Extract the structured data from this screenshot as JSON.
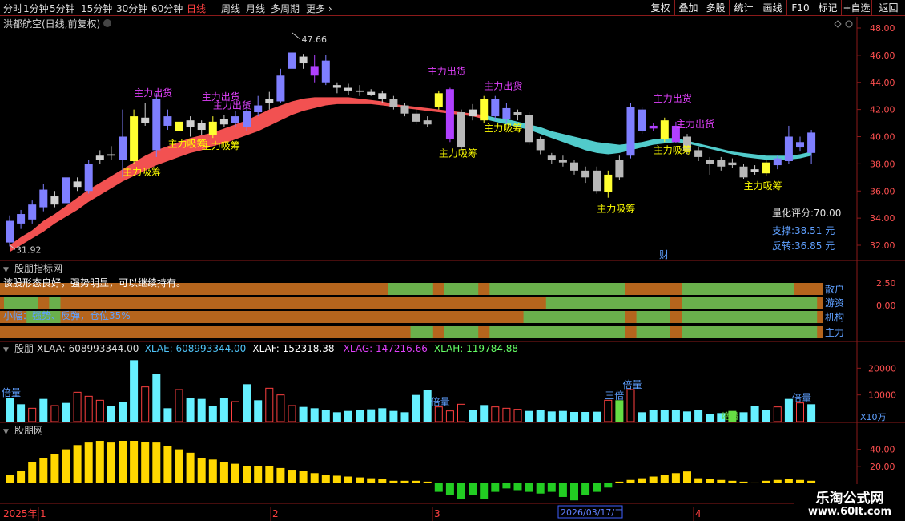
{
  "toolbar": {
    "periods": [
      "分时",
      "1分钟",
      "5分钟",
      "15分钟",
      "30分钟",
      "60分钟",
      "日线",
      "周线",
      "月线",
      "多周期",
      "更多"
    ],
    "active_period": "日线",
    "right_buttons": [
      "复权",
      "叠加",
      "多股",
      "统计",
      "画线",
      "F10",
      "标记",
      "+自选",
      "返回"
    ]
  },
  "main_panel": {
    "title": "洪都航空(日线,前复权)",
    "high_label": "47.66",
    "low_label": "31.92",
    "y_ticks": [
      "48.00",
      "46.00",
      "44.00",
      "42.00",
      "40.00",
      "38.00",
      "36.00",
      "34.00",
      "32.00"
    ],
    "score_label": "量化评分:70.00",
    "support_label": "支撑:38.51 元",
    "reversal_label": "反转:36.85 元",
    "finance_marker": "财",
    "sell_label": "主力出货",
    "buy_label": "主力吸筹"
  },
  "indicator_panel": {
    "title": "股朋指标网",
    "message1": "该股形态良好，强势明显，可以继续持有。",
    "message2": "小幅：强势、反弹，仓位35%",
    "y_ticks": [
      "2.50",
      "0.00"
    ],
    "row_labels": [
      "散户",
      "游资",
      "机构",
      "主力"
    ]
  },
  "volume_panel": {
    "title": "股朋",
    "legend": [
      {
        "label": "XLAA: 608993344.00",
        "color": "#dddddd"
      },
      {
        "label": "XLAE: 608993344.00",
        "color": "#4fc3f7"
      },
      {
        "label": "XLAF: 152318.38",
        "color": "#ffffff"
      },
      {
        "label": "XLAG: 147216.66",
        "color": "#e040fb"
      },
      {
        "label": "XLAH: 119784.88",
        "color": "#66ff66"
      }
    ],
    "y_ticks": [
      "20000",
      "10000"
    ],
    "unit_label": "X10万",
    "double_label": "倍量",
    "triple_label": "三倍",
    "shrink_label": "缩量"
  },
  "osc_panel": {
    "title": "股朋网",
    "y_ticks": [
      "40.00",
      "20.00"
    ]
  },
  "time_axis": {
    "labels": [
      "2025年",
      "1",
      "2",
      "3",
      "4"
    ],
    "cursor_date": "2026/03/17/二"
  },
  "watermark": {
    "title": "乐淘公式网",
    "url": "www.60lt.com"
  },
  "colors": {
    "up": "#ff4040",
    "down": "#8080ff",
    "sell_text": "#e040fb",
    "buy_text": "#ffff00",
    "bar_orange": "#b5651d",
    "bar_green": "#6ab04c",
    "ribbon_red": "#ff5555",
    "ribbon_cyan": "#55d6d6",
    "frame": "#8b1a1a"
  },
  "chart_data": {
    "type": "candlestick",
    "price_range": [
      31,
      49
    ],
    "candles": [
      {
        "o": 32.2,
        "c": 33.8,
        "h": 34.2,
        "l": 31.92,
        "k": "b"
      },
      {
        "o": 33.6,
        "c": 34.3,
        "h": 34.6,
        "l": 33.2,
        "k": "b"
      },
      {
        "o": 33.9,
        "c": 35.0,
        "h": 35.3,
        "l": 33.6,
        "k": "b"
      },
      {
        "o": 34.8,
        "c": 36.1,
        "h": 36.5,
        "l": 34.5,
        "k": "b"
      },
      {
        "o": 35.6,
        "c": 35.0,
        "h": 36.0,
        "l": 34.8,
        "k": "w"
      },
      {
        "o": 35.1,
        "c": 37.0,
        "h": 37.3,
        "l": 34.9,
        "k": "b"
      },
      {
        "o": 36.7,
        "c": 36.3,
        "h": 37.0,
        "l": 36.0,
        "k": "w"
      },
      {
        "o": 36.0,
        "c": 38.0,
        "h": 38.3,
        "l": 35.8,
        "k": "b"
      },
      {
        "o": 38.3,
        "c": 38.6,
        "h": 39.0,
        "l": 38.0,
        "k": "w"
      },
      {
        "o": 38.6,
        "c": 38.7,
        "h": 39.3,
        "l": 38.3,
        "k": "w"
      },
      {
        "o": 38.3,
        "c": 40.0,
        "h": 42.0,
        "l": 37.0,
        "k": "b"
      },
      {
        "o": 38.2,
        "c": 41.5,
        "h": 42.0,
        "l": 38.0,
        "k": "y"
      },
      {
        "o": 41.0,
        "c": 41.4,
        "h": 42.5,
        "l": 40.8,
        "k": "w"
      },
      {
        "o": 39.0,
        "c": 42.8,
        "h": 43.2,
        "l": 38.5,
        "k": "b"
      },
      {
        "o": 41.5,
        "c": 40.8,
        "h": 42.0,
        "l": 40.5,
        "k": "b"
      },
      {
        "o": 41.1,
        "c": 40.4,
        "h": 42.3,
        "l": 40.3,
        "k": "y"
      },
      {
        "o": 40.7,
        "c": 41.2,
        "h": 41.5,
        "l": 40.0,
        "k": "w"
      },
      {
        "o": 40.5,
        "c": 41.0,
        "h": 41.2,
        "l": 40.1,
        "k": "w"
      },
      {
        "o": 41.1,
        "c": 40.1,
        "h": 41.5,
        "l": 39.9,
        "k": "y"
      },
      {
        "o": 40.9,
        "c": 41.3,
        "h": 41.6,
        "l": 40.7,
        "k": "w"
      },
      {
        "o": 41.0,
        "c": 41.5,
        "h": 41.9,
        "l": 40.7,
        "k": "b"
      },
      {
        "o": 40.7,
        "c": 41.9,
        "h": 42.5,
        "l": 40.4,
        "k": "b"
      },
      {
        "o": 41.8,
        "c": 42.3,
        "h": 43.0,
        "l": 41.5,
        "k": "b"
      },
      {
        "o": 42.5,
        "c": 42.8,
        "h": 43.3,
        "l": 42.0,
        "k": "w"
      },
      {
        "o": 42.6,
        "c": 44.5,
        "h": 45.0,
        "l": 42.5,
        "k": "b"
      },
      {
        "o": 45.0,
        "c": 46.2,
        "h": 47.66,
        "l": 44.8,
        "k": "b"
      },
      {
        "o": 45.4,
        "c": 45.9,
        "h": 46.1,
        "l": 45.0,
        "k": "w"
      },
      {
        "o": 45.2,
        "c": 44.5,
        "h": 46.0,
        "l": 44.0,
        "k": "p"
      },
      {
        "o": 45.6,
        "c": 44.0,
        "h": 46.0,
        "l": 43.8,
        "k": "b"
      },
      {
        "o": 43.8,
        "c": 43.6,
        "h": 44.0,
        "l": 43.2,
        "k": "w"
      },
      {
        "o": 43.6,
        "c": 43.4,
        "h": 43.9,
        "l": 43.1,
        "k": "w"
      },
      {
        "o": 43.4,
        "c": 43.3,
        "h": 43.8,
        "l": 43.0,
        "k": "w"
      },
      {
        "o": 43.3,
        "c": 43.1,
        "h": 43.5,
        "l": 43.0,
        "k": "w"
      },
      {
        "o": 43.2,
        "c": 42.8,
        "h": 43.4,
        "l": 42.5,
        "k": "w"
      },
      {
        "o": 42.8,
        "c": 42.2,
        "h": 43.0,
        "l": 42.0,
        "k": "g"
      },
      {
        "o": 42.3,
        "c": 41.7,
        "h": 42.5,
        "l": 41.5,
        "k": "g"
      },
      {
        "o": 41.7,
        "c": 41.1,
        "h": 42.0,
        "l": 40.9,
        "k": "g"
      },
      {
        "o": 41.2,
        "c": 40.9,
        "h": 41.5,
        "l": 40.7,
        "k": "g"
      },
      {
        "o": 42.2,
        "c": 43.2,
        "h": 43.4,
        "l": 42.0,
        "k": "y"
      },
      {
        "o": 43.5,
        "c": 39.8,
        "h": 43.6,
        "l": 39.6,
        "k": "p"
      },
      {
        "o": 41.8,
        "c": 39.2,
        "h": 42.0,
        "l": 39.0,
        "k": "g"
      },
      {
        "o": 41.5,
        "c": 42.0,
        "h": 42.4,
        "l": 41.2,
        "k": "w"
      },
      {
        "o": 41.2,
        "c": 42.8,
        "h": 43.0,
        "l": 41.0,
        "k": "y"
      },
      {
        "o": 42.8,
        "c": 41.5,
        "h": 43.0,
        "l": 41.2,
        "k": "b"
      },
      {
        "o": 42.1,
        "c": 41.3,
        "h": 42.5,
        "l": 41.0,
        "k": "b"
      },
      {
        "o": 41.8,
        "c": 41.6,
        "h": 42.0,
        "l": 41.2,
        "k": "g"
      },
      {
        "o": 41.6,
        "c": 39.6,
        "h": 41.8,
        "l": 39.4,
        "k": "g"
      },
      {
        "o": 39.8,
        "c": 39.0,
        "h": 40.0,
        "l": 38.7,
        "k": "g"
      },
      {
        "o": 38.6,
        "c": 38.3,
        "h": 38.8,
        "l": 38.0,
        "k": "g"
      },
      {
        "o": 38.3,
        "c": 38.1,
        "h": 38.6,
        "l": 37.8,
        "k": "g"
      },
      {
        "o": 38.1,
        "c": 37.5,
        "h": 38.3,
        "l": 37.2,
        "k": "g"
      },
      {
        "o": 37.5,
        "c": 37.0,
        "h": 37.8,
        "l": 36.6,
        "k": "g"
      },
      {
        "o": 37.5,
        "c": 36.0,
        "h": 37.8,
        "l": 35.8,
        "k": "g"
      },
      {
        "o": 35.9,
        "c": 37.2,
        "h": 37.5,
        "l": 35.5,
        "k": "y"
      },
      {
        "o": 37.0,
        "c": 38.3,
        "h": 38.6,
        "l": 36.8,
        "k": "g"
      },
      {
        "o": 38.6,
        "c": 42.2,
        "h": 42.5,
        "l": 38.4,
        "k": "b"
      },
      {
        "o": 42.0,
        "c": 40.4,
        "h": 42.2,
        "l": 40.2,
        "k": "b"
      },
      {
        "o": 40.6,
        "c": 40.8,
        "h": 41.0,
        "l": 40.4,
        "k": "p"
      },
      {
        "o": 41.2,
        "c": 39.8,
        "h": 41.4,
        "l": 39.6,
        "k": "y"
      },
      {
        "o": 40.8,
        "c": 39.6,
        "h": 41.1,
        "l": 39.5,
        "k": "p"
      },
      {
        "o": 40.0,
        "c": 39.0,
        "h": 40.2,
        "l": 38.7,
        "k": "g"
      },
      {
        "o": 39.0,
        "c": 38.5,
        "h": 39.2,
        "l": 38.2,
        "k": "g"
      },
      {
        "o": 38.3,
        "c": 38.0,
        "h": 38.5,
        "l": 37.2,
        "k": "g"
      },
      {
        "o": 38.3,
        "c": 37.8,
        "h": 38.5,
        "l": 37.5,
        "k": "g"
      },
      {
        "o": 38.1,
        "c": 37.9,
        "h": 38.4,
        "l": 37.7,
        "k": "g"
      },
      {
        "o": 37.8,
        "c": 37.0,
        "h": 38.0,
        "l": 36.9,
        "k": "g"
      },
      {
        "o": 37.4,
        "c": 37.6,
        "h": 37.9,
        "l": 37.2,
        "k": "w"
      },
      {
        "o": 37.3,
        "c": 38.1,
        "h": 38.3,
        "l": 37.1,
        "k": "y"
      },
      {
        "o": 38.4,
        "c": 37.9,
        "h": 38.6,
        "l": 37.6,
        "k": "b"
      },
      {
        "o": 38.2,
        "c": 40.0,
        "h": 40.8,
        "l": 38.0,
        "k": "b"
      },
      {
        "o": 39.6,
        "c": 39.2,
        "h": 40.0,
        "l": 38.9,
        "k": "b"
      },
      {
        "o": 38.8,
        "c": 40.3,
        "h": 40.5,
        "l": 38.0,
        "k": "b"
      }
    ],
    "sell_signals": [
      12,
      18,
      19,
      38,
      43,
      58,
      60
    ],
    "buy_signals": [
      11,
      15,
      18,
      39,
      43,
      53,
      58,
      66
    ],
    "ribbon_upper": [
      32.0,
      32.6,
      33.1,
      33.8,
      34.3,
      34.9,
      35.5,
      36.1,
      36.6,
      37.1,
      37.6,
      38.1,
      38.6,
      39.0,
      39.3,
      39.6,
      39.9,
      40.1,
      40.3,
      40.6,
      40.9,
      41.2,
      41.6,
      42.0,
      42.3,
      42.6,
      42.8,
      42.9,
      42.9,
      42.9,
      42.9,
      42.8,
      42.7,
      42.6,
      42.4,
      42.3,
      42.2,
      42.1,
      42.0,
      41.9,
      41.8,
      41.7,
      41.6,
      41.4,
      41.3,
      41.1,
      40.9,
      40.7,
      40.4,
      40.2,
      40.0,
      39.8,
      39.6,
      39.5,
      39.4,
      39.5,
      39.6,
      39.8,
      39.9,
      39.9,
      39.7,
      39.5,
      39.3,
      39.1,
      38.9,
      38.8,
      38.7,
      38.6,
      38.6,
      38.6,
      38.7,
      38.9
    ],
    "ribbon_lower": [
      31.5,
      32.0,
      32.5,
      33.0,
      33.6,
      34.1,
      34.6,
      35.2,
      35.7,
      36.2,
      36.7,
      37.1,
      37.5,
      37.9,
      38.2,
      38.5,
      38.8,
      39.0,
      39.3,
      39.5,
      39.8,
      40.1,
      40.4,
      40.8,
      41.2,
      41.6,
      41.9,
      42.1,
      42.3,
      42.4,
      42.4,
      42.4,
      42.4,
      42.3,
      42.2,
      42.1,
      42.0,
      41.9,
      41.8,
      41.7,
      41.6,
      41.5,
      41.3,
      41.1,
      40.9,
      40.7,
      40.5,
      40.2,
      39.9,
      39.6,
      39.3,
      39.0,
      38.8,
      38.7,
      38.8,
      39.0,
      39.2,
      39.4,
      39.5,
      39.6,
      39.5,
      39.3,
      39.1,
      38.9,
      38.7,
      38.5,
      38.4,
      38.3,
      38.3,
      38.3,
      38.4,
      38.6
    ],
    "ribbon_color_switch_index": 42,
    "indicator_rows": [
      {
        "name": "散户",
        "green_ranges": [
          [
            34,
            38
          ],
          [
            39,
            42
          ],
          [
            43,
            55
          ],
          [
            60,
            70
          ]
        ]
      },
      {
        "name": "游资",
        "green_ranges": [
          [
            0,
            3
          ],
          [
            4,
            5
          ],
          [
            48,
            59
          ],
          [
            60,
            72
          ]
        ]
      },
      {
        "name": "机构",
        "green_ranges": [
          [
            2,
            5
          ],
          [
            46,
            55
          ],
          [
            56,
            59
          ],
          [
            60,
            72
          ]
        ]
      },
      {
        "name": "主力",
        "green_ranges": [
          [
            36,
            38
          ],
          [
            39,
            42
          ],
          [
            43,
            55
          ],
          [
            56,
            59
          ],
          [
            60,
            72
          ]
        ]
      }
    ],
    "volume": [
      9000,
      6500,
      5000,
      8500,
      6000,
      7000,
      11000,
      9500,
      8000,
      6000,
      7500,
      23000,
      13000,
      18000,
      5000,
      12000,
      9000,
      8500,
      6000,
      9000,
      7500,
      14000,
      8000,
      12500,
      10000,
      6000,
      5500,
      5000,
      4500,
      3500,
      4000,
      4200,
      4600,
      5000,
      4000,
      3500,
      10000,
      12000,
      5500,
      4000,
      6500,
      4500,
      6200,
      5500,
      5000,
      4600,
      4000,
      4200,
      3800,
      4000,
      3600,
      3600,
      3700,
      8000,
      8000,
      12000,
      3500,
      4500,
      4500,
      4200,
      3800,
      4200,
      3000,
      3200,
      4000,
      3500,
      6000,
      4500,
      5500,
      8500,
      7000,
      6500
    ],
    "volume_kinds": [
      "c",
      "c",
      "h",
      "c",
      "h",
      "c",
      "h",
      "h",
      "h",
      "c",
      "c",
      "c",
      "h",
      "c",
      "c",
      "h",
      "c",
      "c",
      "c",
      "c",
      "h",
      "c",
      "c",
      "h",
      "h",
      "h",
      "c",
      "c",
      "c",
      "c",
      "c",
      "c",
      "c",
      "c",
      "c",
      "c",
      "c",
      "c",
      "h",
      "h",
      "h",
      "c",
      "c",
      "h",
      "h",
      "h",
      "c",
      "c",
      "c",
      "c",
      "c",
      "c",
      "c",
      "h",
      "g",
      "h",
      "c",
      "c",
      "c",
      "c",
      "c",
      "c",
      "c",
      "c",
      "g",
      "c",
      "c",
      "c",
      "h",
      "c",
      "h",
      "c"
    ],
    "oscillator": [
      10,
      15,
      25,
      30,
      34,
      40,
      45,
      48,
      50,
      48,
      50,
      50,
      49,
      48,
      44,
      40,
      36,
      30,
      28,
      25,
      23,
      20,
      20,
      20,
      18,
      16,
      15,
      12,
      10,
      9,
      8,
      7,
      6,
      5,
      3,
      3,
      3,
      2,
      -10,
      -14,
      -18,
      -14,
      -18,
      -10,
      -6,
      -8,
      -10,
      -12,
      -10,
      -16,
      -20,
      -14,
      -10,
      -5,
      2,
      4,
      6,
      8,
      10,
      12,
      14,
      6,
      5,
      4,
      3,
      2,
      1,
      3,
      4,
      5,
      4,
      3
    ]
  }
}
